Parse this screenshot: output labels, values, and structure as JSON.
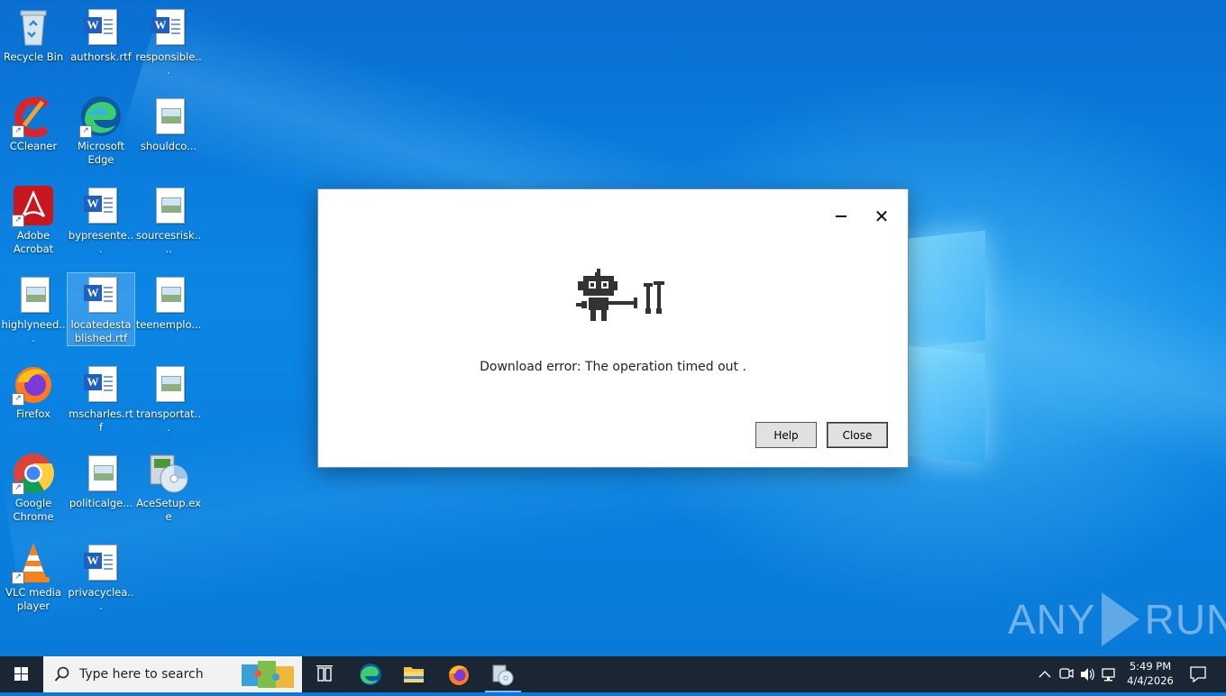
{
  "desktop": {
    "icons": [
      {
        "label": "Recycle Bin"
      },
      {
        "label": "authorsk.rtf"
      },
      {
        "label": "responsible..."
      },
      {
        "label": "CCleaner"
      },
      {
        "label": "Microsoft Edge"
      },
      {
        "label": "shouldco..."
      },
      {
        "label": "Adobe Acrobat"
      },
      {
        "label": "bypresente..."
      },
      {
        "label": "sourcesrisk...."
      },
      {
        "label": "highlyneed..."
      },
      {
        "label": "locatedestablished.rtf"
      },
      {
        "label": "teenemplo..."
      },
      {
        "label": "Firefox"
      },
      {
        "label": "mscharles.rtf"
      },
      {
        "label": "transportat..."
      },
      {
        "label": "Google Chrome"
      },
      {
        "label": "politicalge..."
      },
      {
        "label": "AceSetup.exe"
      },
      {
        "label": "VLC media player"
      },
      {
        "label": "privacyclea..."
      }
    ]
  },
  "dialog": {
    "message": "Download error: The operation timed out .",
    "help_label": "Help",
    "close_label": "Close",
    "close_glyph": "✕"
  },
  "watermark": {
    "left": "ANY",
    "right": "RUN"
  },
  "taskbar": {
    "search_placeholder": "Type here to search",
    "time": "5:49 PM",
    "date": "4/4/2026",
    "apps": [
      "task-view",
      "microsoft-edge",
      "file-explorer",
      "firefox",
      "acesetup"
    ]
  },
  "colors": {
    "desktop_blue": "#0a78d7",
    "taskbar": "#1a2634",
    "dialog_bg": "#ffffff",
    "button_bg": "#e1e1e1"
  }
}
